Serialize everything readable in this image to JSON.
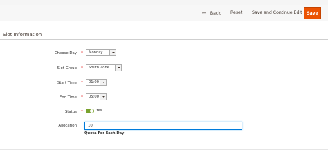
{
  "header": {
    "back_label": "Back",
    "back_arrow": "←",
    "reset_label": "Reset",
    "save_continue_label": "Save and Continue Edit",
    "save_label": "Save",
    "save_color": "#eb5202"
  },
  "section": {
    "title": "Slot Information"
  },
  "form": {
    "required_mark": "*",
    "choose_day": {
      "label": "Choose Day",
      "value": "Monday"
    },
    "slot_group": {
      "label": "Slot Group",
      "value": "South Zone"
    },
    "start_time": {
      "label": "Start Time",
      "value": "01:00"
    },
    "end_time": {
      "label": "End Time",
      "value": "05:00"
    },
    "status": {
      "label": "Status",
      "toggle_label": "Yes",
      "enabled": true,
      "toggle_color": "#79a22e"
    },
    "allocation": {
      "label": "Allocation",
      "value": "10",
      "note": "Quota For Each Day"
    }
  }
}
